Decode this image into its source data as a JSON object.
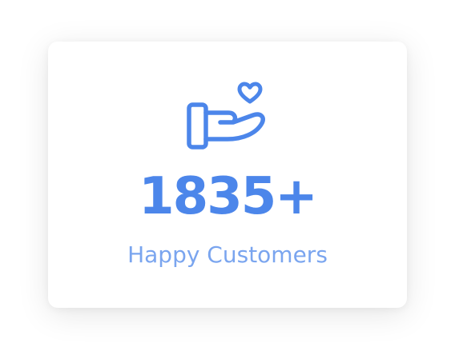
{
  "stat": {
    "value": "1835+",
    "label": "Happy Customers",
    "icon": "hand-heart-icon"
  },
  "colors": {
    "accent": "#4c86ea",
    "label": "#7aa5ef",
    "card_background": "#ffffff"
  }
}
